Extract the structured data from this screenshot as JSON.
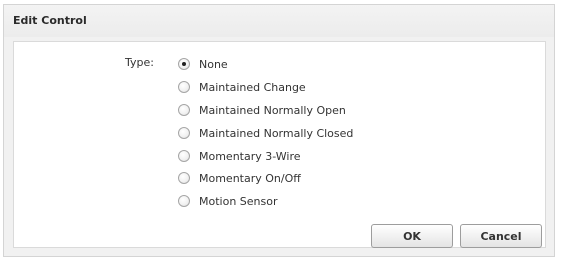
{
  "dialog": {
    "title": "Edit Control",
    "type_label": "Type:",
    "options": [
      {
        "label": "None",
        "selected": true
      },
      {
        "label": "Maintained Change",
        "selected": false
      },
      {
        "label": "Maintained Normally Open",
        "selected": false
      },
      {
        "label": "Maintained Normally Closed",
        "selected": false
      },
      {
        "label": "Momentary 3-Wire",
        "selected": false
      },
      {
        "label": "Momentary On/Off",
        "selected": false
      },
      {
        "label": "Motion Sensor",
        "selected": false
      }
    ],
    "ok_label": "OK",
    "cancel_label": "Cancel"
  }
}
